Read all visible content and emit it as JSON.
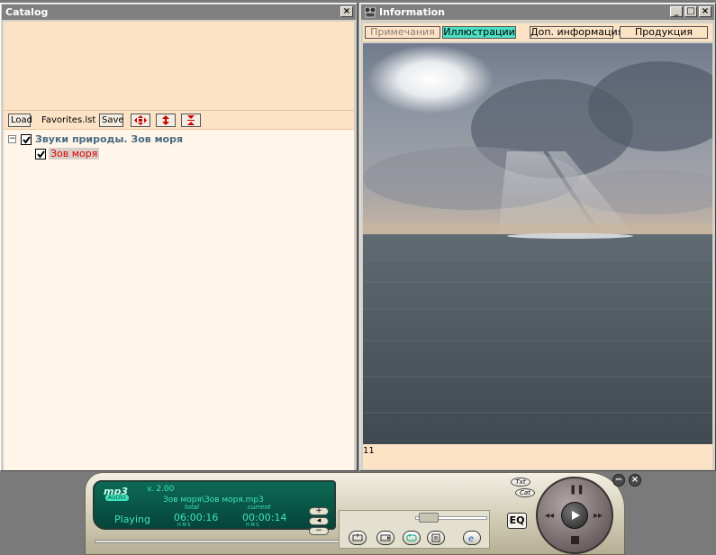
{
  "catalog": {
    "title": "Catalog",
    "toolbar": {
      "load_label": "Load",
      "file_label": "Favorites.lst",
      "save_label": "Save"
    },
    "tree": {
      "root_label": "Звуки природы. Зов моря",
      "root_expander": "−",
      "root_checked": true,
      "child_label": "Зов моря",
      "child_checked": true,
      "child_color": "#e00000"
    }
  },
  "info": {
    "title": "Information",
    "tabs": [
      {
        "label": "Примечания"
      },
      {
        "label": "Иллюстрации"
      },
      {
        "label": "Доп. информация"
      },
      {
        "label": "Продукция"
      }
    ],
    "active_tab": 1,
    "status_text": "11"
  },
  "player": {
    "logo_main": "mp3",
    "logo_sub": "AUDIO",
    "version": "v. 2.00",
    "track": "Зов моря\\Зов моря.mp3",
    "state": "Playing",
    "total_label": "total",
    "total_time": "06:00:16",
    "current_label": "current",
    "current_time": "00:00:14",
    "hms_label": "H  M  S",
    "eq_label": "EQ",
    "txt_label": "Txt",
    "cat_label": "Cat",
    "progress_fraction": 0.0,
    "lcd_color": "#3fe3c0"
  }
}
